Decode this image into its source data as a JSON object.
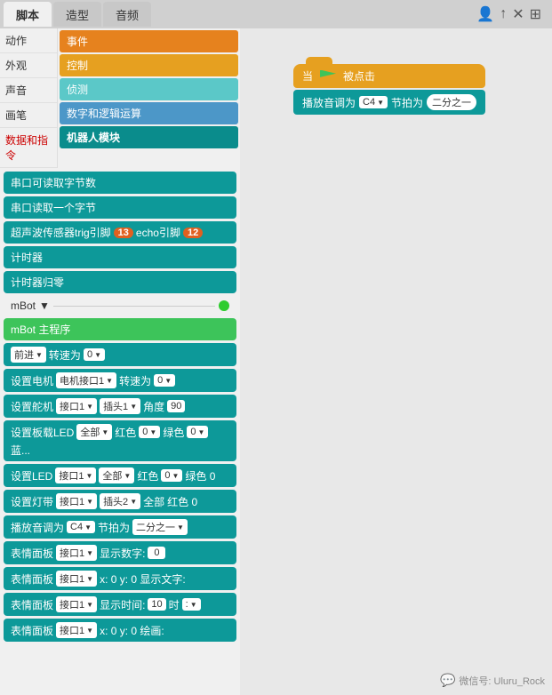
{
  "tabs": [
    {
      "label": "脚本",
      "active": true
    },
    {
      "label": "造型",
      "active": false
    },
    {
      "label": "音频",
      "active": false
    }
  ],
  "toolbar_icons": [
    "person-add",
    "arrow-up",
    "fullscreen",
    "layout"
  ],
  "left_categories": [
    {
      "label": "动作",
      "color": "#4c8fdb"
    },
    {
      "label": "外观",
      "color": "#9966ff"
    },
    {
      "label": "声音",
      "color": "#cc66ff"
    },
    {
      "label": "画笔",
      "color": "#59c059"
    },
    {
      "label": "数据和指令",
      "color": "#ff8c1a",
      "special": "red"
    }
  ],
  "right_categories": [
    {
      "label": "事件",
      "color_class": "orange"
    },
    {
      "label": "控制",
      "color_class": "gold"
    },
    {
      "label": "侦测",
      "color_class": "cyan"
    },
    {
      "label": "数字和逻辑运算",
      "color_class": "blue"
    },
    {
      "label": "机器人模块",
      "color_class": "teal-dark"
    }
  ],
  "blocks": [
    {
      "text": "串口可读取字节数",
      "type": "teal"
    },
    {
      "text": "串口读取一个字节",
      "type": "teal"
    },
    {
      "text": "超声波传感器trig引脚",
      "badge1": "13",
      "badge2": "echo引脚",
      "badge3": "12",
      "type": "teal"
    },
    {
      "text": "计时器",
      "type": "teal"
    },
    {
      "text": "计时器归零",
      "type": "teal"
    }
  ],
  "mbot_label": "mBot",
  "mbot_blocks": [
    {
      "text": "mBot 主程序",
      "type": "green-block"
    },
    {
      "text": "前进",
      "dropdown1": "前进",
      "text2": "转速为",
      "dropdown2": "0",
      "type": "teal"
    },
    {
      "text": "设置电机 电机接口1",
      "dropdown1": "电机接口1",
      "text2": "转速为",
      "dropdown2": "0",
      "type": "teal"
    },
    {
      "text": "设置舵机 接口1",
      "dropdown1": "接口1",
      "text2": "插头1",
      "dropdown2": "插头1",
      "text3": "角度",
      "input": "90",
      "type": "teal"
    },
    {
      "text": "设置板载LED 全部",
      "dropdown1": "全部",
      "text2": "红色",
      "dropdown2": "0",
      "text3": "绿色",
      "dropdown3": "0",
      "text4": "蓝...",
      "type": "teal"
    },
    {
      "text": "设置LED 接口1",
      "dropdown1": "接口1",
      "text2": "全部",
      "dropdown2": "全部",
      "text3": "红色",
      "dropdown3": "0",
      "text4": "绿色 0",
      "type": "teal"
    },
    {
      "text": "设置灯带 接口1",
      "dropdown1": "接口1",
      "text2": "插头2",
      "dropdown2": "插头2",
      "text3": "全部",
      "text4": "红色 0",
      "type": "teal"
    },
    {
      "text": "播放音调为 C4",
      "dropdown1": "C4",
      "text2": "节拍为",
      "dropdown2": "二分之一",
      "type": "teal"
    },
    {
      "text": "表情面板 接口1",
      "dropdown1": "接口1",
      "text2": "显示数字:",
      "input": "0",
      "type": "teal"
    },
    {
      "text": "表情面板 接口1",
      "dropdown1": "接口1",
      "text2": "x: 0  y:",
      "input2": "0",
      "text3": "显示文字:",
      "type": "teal"
    },
    {
      "text": "表情面板 接口1",
      "dropdown1": "接口1",
      "text2": "显示时间:",
      "input": "10",
      "text3": "时",
      "dropdown3": "▼",
      "type": "teal"
    },
    {
      "text": "表情面板 接口1",
      "dropdown1": "接口1",
      "text2": "x: 0  y:",
      "input": "0",
      "text3": "绘画:",
      "type": "teal"
    }
  ],
  "canvas": {
    "hat_block": {
      "prefix": "当",
      "suffix": "被点击"
    },
    "play_block": {
      "prefix": "播放音调为",
      "dropdown1": "C4",
      "middle": "节拍为",
      "dropdown2": "二分之一"
    }
  },
  "watermark": {
    "icon": "💬",
    "text": "微信号: Uluru_Rock"
  }
}
